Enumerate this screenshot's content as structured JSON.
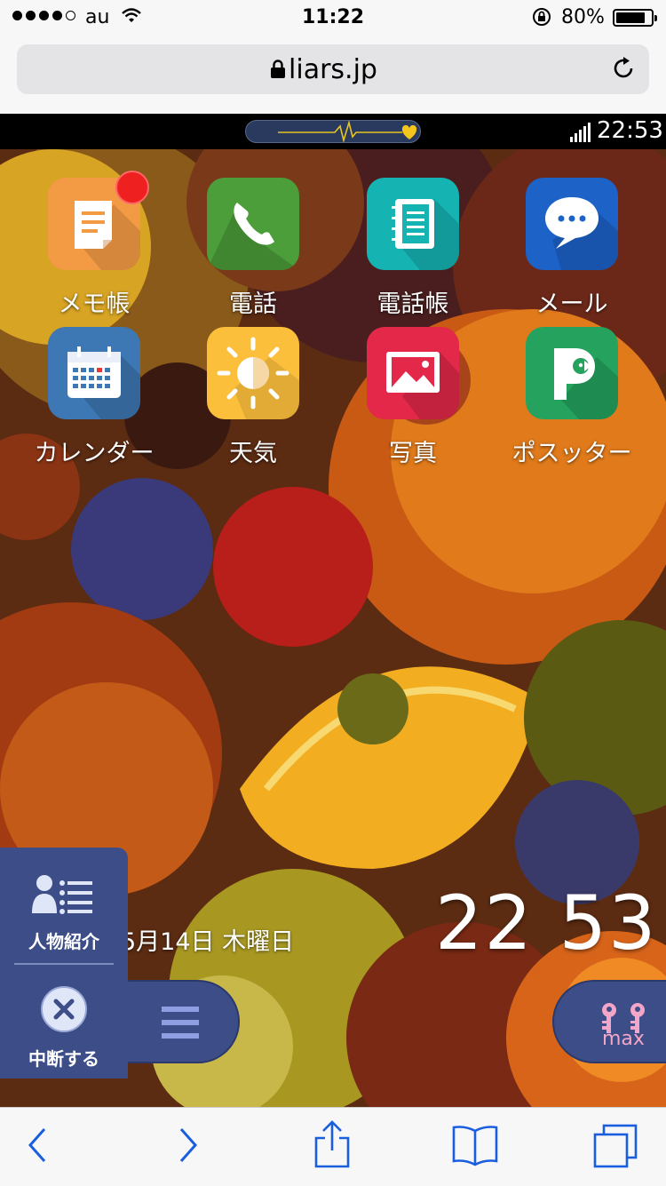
{
  "status_bar": {
    "carrier": "au",
    "time": "11:22",
    "battery": "80%",
    "battery_level": 0.8,
    "signal_dots_filled": 4
  },
  "browser": {
    "url": "liars.jp",
    "back_icon": "chevron-left-icon",
    "forward_icon": "chevron-right-icon",
    "share_icon": "share-icon",
    "bookmarks_icon": "book-icon",
    "tabs_icon": "tabs-icon"
  },
  "game": {
    "phone_time": "22:53",
    "apps": [
      {
        "label": "メモ帳",
        "icon": "memo-icon",
        "color": "#f39a44",
        "badge": true
      },
      {
        "label": "電話",
        "icon": "phone-icon",
        "color": "#4c9e3a",
        "badge": false
      },
      {
        "label": "電話帳",
        "icon": "address-book-icon",
        "color": "#16b3b3",
        "badge": false
      },
      {
        "label": "メール",
        "icon": "mail-bubble-icon",
        "color": "#1c62c7",
        "badge": false
      },
      {
        "label": "カレンダー",
        "icon": "calendar-icon",
        "color": "#3d77b4",
        "badge": false
      },
      {
        "label": "天気",
        "icon": "sun-icon",
        "color": "#fbbf3b",
        "badge": false
      },
      {
        "label": "写真",
        "icon": "photo-icon",
        "color": "#e3284a",
        "badge": false
      },
      {
        "label": "ポスッター",
        "icon": "postter-icon",
        "color": "#24a25e",
        "badge": false
      }
    ],
    "clock_big": "22 53",
    "date": "5月14日 木曜日",
    "menu_icon": "hamburger-icon",
    "keys_label": "max",
    "side_panel": {
      "profile_label": "人物紹介",
      "quit_label": "中断する"
    }
  }
}
